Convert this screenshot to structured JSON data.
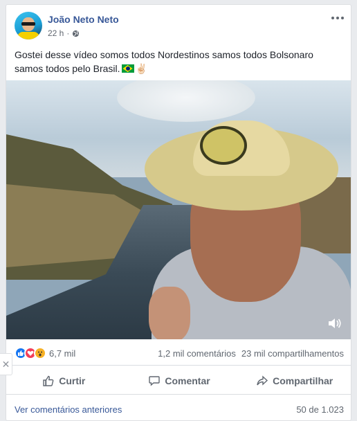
{
  "post": {
    "author": "João Neto Neto",
    "time": "22 h",
    "visibility_icon": "globe-icon",
    "more_icon": "ellipsis-icon",
    "text": "Gostei desse vídeo somos todos Nordestinos samos todos Bolsonaro samos todos pelo Brasil.",
    "text_emoji_1": "brazil-flag",
    "text_emoji_2": "✌🏻"
  },
  "video": {
    "volume_icon": "speaker-icon"
  },
  "stats": {
    "reaction_count": "6,7 mil",
    "comments": "1,2 mil comentários",
    "shares": "23 mil compartilhamentos"
  },
  "actions": {
    "like": "Curtir",
    "comment": "Comentar",
    "share": "Compartilhar"
  },
  "footer": {
    "previous_comments": "Ver comentários anteriores",
    "pagination": "50 de 1.023"
  },
  "side": {
    "close_glyph": "✕"
  },
  "colors": {
    "link": "#385898",
    "meta": "#606770",
    "like": "#1877f2",
    "love": "#f33e58",
    "wow": "#f7b125"
  }
}
